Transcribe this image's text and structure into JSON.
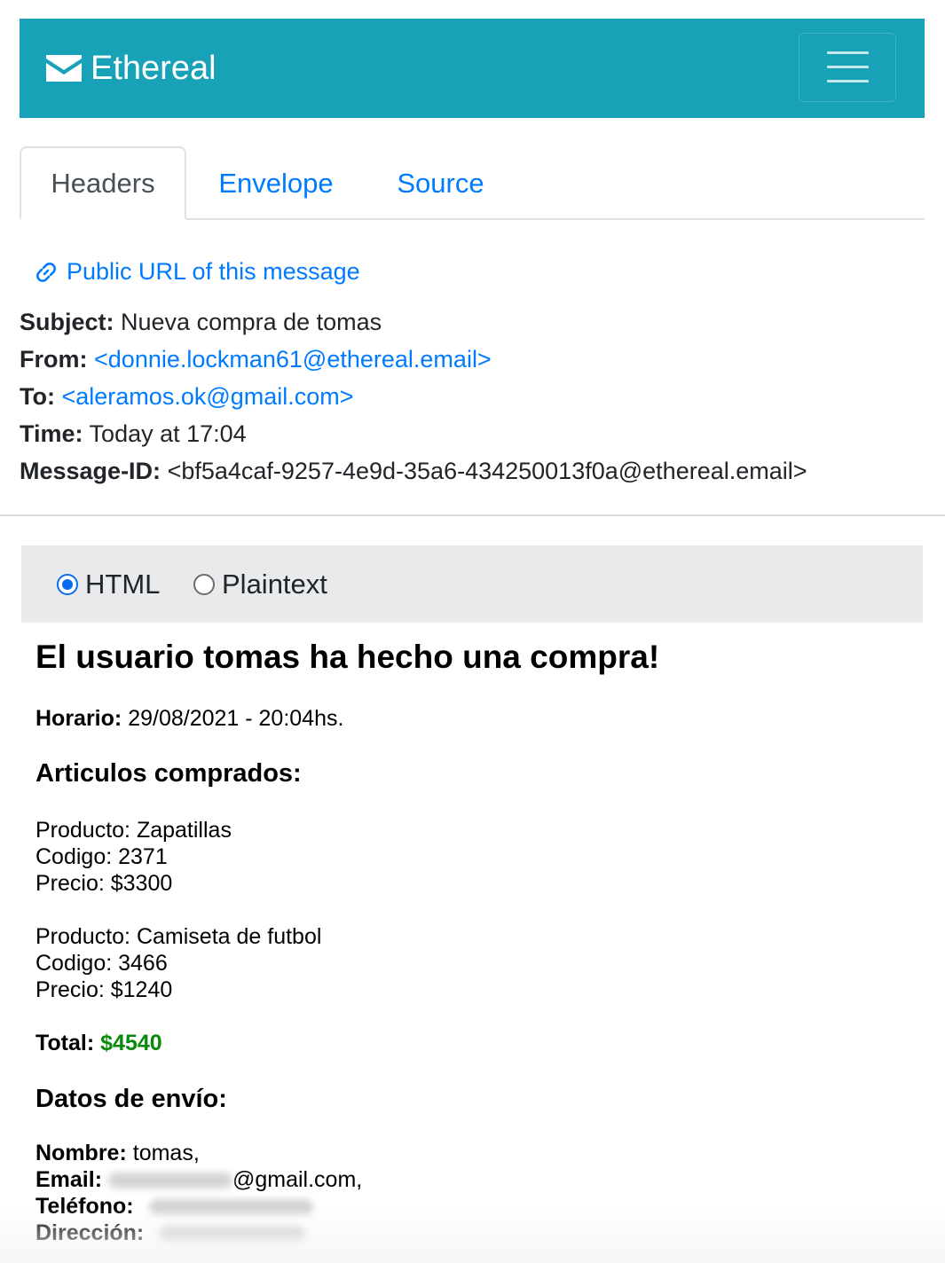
{
  "app": {
    "brand": "Ethereal"
  },
  "tabs": [
    {
      "label": "Headers"
    },
    {
      "label": "Envelope"
    },
    {
      "label": "Source"
    }
  ],
  "public_url_label": "Public URL of this message",
  "headers": {
    "subject": {
      "label": "Subject:",
      "value": "Nueva compra de tomas"
    },
    "from": {
      "label": "From:",
      "value": "<donnie.lockman61@ethereal.email>"
    },
    "to": {
      "label": "To:",
      "value": "<aleramos.ok@gmail.com>"
    },
    "time": {
      "label": "Time:",
      "value": "Today at 17:04"
    },
    "message_id": {
      "label": "Message-ID:",
      "value": "<bf5a4caf-9257-4e9d-35a6-434250013f0a@ethereal.email>"
    }
  },
  "view_options": [
    {
      "label": "HTML",
      "selected": true
    },
    {
      "label": "Plaintext",
      "selected": false
    }
  ],
  "email": {
    "title": "El usuario tomas ha hecho una compra!",
    "horario": {
      "label": "Horario:",
      "value": "29/08/2021 - 20:04hs."
    },
    "articles_heading": "Articulos comprados:",
    "items": [
      {
        "producto": "Producto: Zapatillas",
        "codigo": "Codigo: 2371",
        "precio": "Precio: $3300"
      },
      {
        "producto": "Producto: Camiseta de futbol",
        "codigo": "Codigo: 3466",
        "precio": "Precio: $1240"
      }
    ],
    "total": {
      "label": "Total:",
      "value": "$4540"
    },
    "shipping_heading": "Datos de envío:",
    "shipping": {
      "nombre": {
        "label": "Nombre:",
        "value": "tomas,"
      },
      "email": {
        "label": "Email:",
        "value": "@gmail.com,"
      },
      "telefono": {
        "label": "Teléfono:"
      },
      "direccion": {
        "label": "Dirección:"
      }
    }
  },
  "colors": {
    "navbar": "#17a2b8",
    "link": "#007bff",
    "total": "#0a8a0a"
  }
}
